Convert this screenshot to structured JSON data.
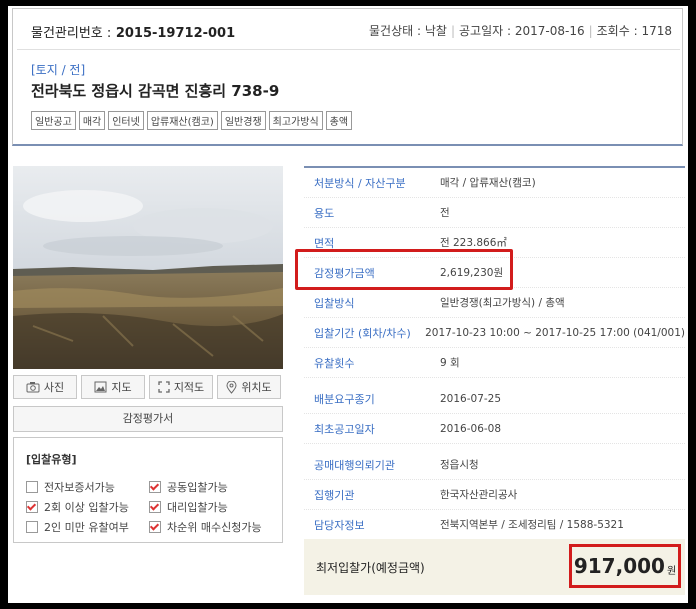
{
  "header": {
    "mgmt_label": "물건관리번호 :",
    "mgmt_no": "2015-19712-001",
    "status_label": "물건상태 :",
    "status": "낙찰",
    "notice_label": "공고일자 :",
    "notice_date": "2017-08-16",
    "views_label": "조회수 :",
    "views": "1718",
    "category": "[토지 / 전]",
    "address": "전라북도 정읍시 감곡면 진흥리 738-9",
    "tags": [
      "일반공고",
      "매각",
      "인터넷",
      "압류재산(캠코)",
      "일반경쟁",
      "최고가방식",
      "총액"
    ]
  },
  "buttons": {
    "photo": "사진",
    "map": "지도",
    "cadastral": "지적도",
    "location": "위치도",
    "appraisal": "감정평가서"
  },
  "bid_type": {
    "title": "[입찰유형]",
    "options": [
      {
        "label": "전자보증서가능",
        "checked": false
      },
      {
        "label": "공동입찰가능",
        "checked": true
      },
      {
        "label": "2회 이상 입찰가능",
        "checked": true
      },
      {
        "label": "대리입찰가능",
        "checked": true
      },
      {
        "label": "2인 미만 유찰여부",
        "checked": false
      },
      {
        "label": "차순위 매수신청가능",
        "checked": true
      }
    ]
  },
  "info": [
    {
      "key": "처분방식 / 자산구분",
      "value": "매각 / 압류재산(캠코)"
    },
    {
      "key": "용도",
      "value": "전"
    },
    {
      "key": "면적",
      "value": "전 223.866㎡"
    },
    {
      "key": "감정평가금액",
      "value": "2,619,230원"
    },
    {
      "key": "입찰방식",
      "value": "일반경쟁(최고가방식) / 총액"
    },
    {
      "key": "입찰기간 (회차/차수)",
      "value": "2017-10-23 10:00 ~ 2017-10-25 17:00 (041/001)"
    },
    {
      "key": "유찰횟수",
      "value": "9 회"
    },
    {
      "key": "배분요구종기",
      "value": "2016-07-25"
    },
    {
      "key": "최초공고일자",
      "value": "2016-06-08"
    },
    {
      "key": "공매대행의뢰기관",
      "value": "정읍시청"
    },
    {
      "key": "집행기관",
      "value": "한국자산관리공사"
    },
    {
      "key": "담당자정보",
      "value": "전북지역본부 / 조세정리팀 / 1588-5321"
    }
  ],
  "min_bid": {
    "label": "최저입찰가(예정금액)",
    "amount": "917,000",
    "unit": "원"
  },
  "colors": {
    "accent_blue": "#3b6fc4",
    "highlight_red": "#d21c1c",
    "price_bg": "#f4f2e6"
  }
}
